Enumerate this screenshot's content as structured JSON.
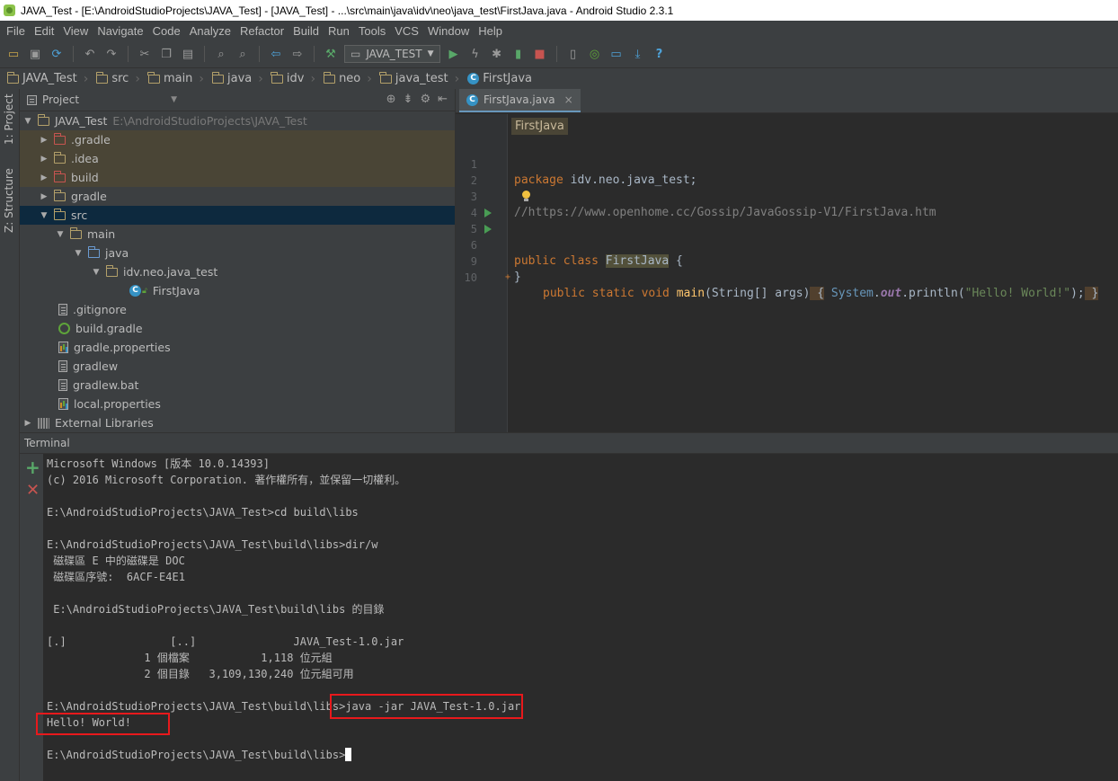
{
  "window": {
    "title": "JAVA_Test - [E:\\AndroidStudioProjects\\JAVA_Test] - [JAVA_Test] - ...\\src\\main\\java\\idv\\neo\\java_test\\FirstJava.java - Android Studio 2.3.1"
  },
  "menu": [
    "File",
    "Edit",
    "View",
    "Navigate",
    "Code",
    "Analyze",
    "Refactor",
    "Build",
    "Run",
    "Tools",
    "VCS",
    "Window",
    "Help"
  ],
  "toolbar": {
    "run_config": "JAVA_TEST"
  },
  "breadcrumb": [
    "JAVA_Test",
    "src",
    "main",
    "java",
    "idv",
    "neo",
    "java_test",
    "FirstJava"
  ],
  "side_tabs": {
    "project": "1: Project",
    "structure": "Z: Structure"
  },
  "project_panel": {
    "header": "Project",
    "root": {
      "name": "JAVA_Test",
      "path": "E:\\AndroidStudioProjects\\JAVA_Test"
    },
    "items": [
      ".gradle",
      ".idea",
      "build",
      "gradle",
      "src",
      "main",
      "java",
      "idv.neo.java_test",
      "FirstJava",
      ".gitignore",
      "build.gradle",
      "gradle.properties",
      "gradlew",
      "gradlew.bat",
      "local.properties",
      "External Libraries"
    ]
  },
  "editor": {
    "tab": "FirstJava.java",
    "crumb": "FirstJava",
    "line_numbers": [
      "1",
      "2",
      "3",
      "4",
      "5",
      "6",
      "9",
      "10"
    ],
    "line1": {
      "kw": "package",
      "rest": " idv.neo.java_test;"
    },
    "line3": "//https://www.openhome.cc/Gossip/JavaGossip-V1/FirstJava.htm",
    "line5": {
      "kw": "public class",
      "cls": "FirstJava",
      "rest": " {"
    },
    "line6": {
      "kw": "public static void",
      "meth": "main",
      "p1": "(String[] args)",
      "b1": " {",
      "sys": "System",
      "dot": ".",
      "out": "out",
      "call": ".println(",
      "str": "\"Hello! World!\"",
      "end": ");",
      "b2": " }"
    },
    "line9": "}"
  },
  "terminal": {
    "header": "Terminal",
    "lines": [
      "Microsoft Windows [版本 10.0.14393]",
      "(c) 2016 Microsoft Corporation. 著作權所有，並保留一切權利。",
      "",
      "E:\\AndroidStudioProjects\\JAVA_Test>cd build\\libs",
      "",
      "E:\\AndroidStudioProjects\\JAVA_Test\\build\\libs>dir/w",
      " 磁碟區 E 中的磁碟是 DOC",
      " 磁碟區序號:  6ACF-E4E1",
      "",
      " E:\\AndroidStudioProjects\\JAVA_Test\\build\\libs 的目錄",
      "",
      "[.]                [..]               JAVA_Test-1.0.jar",
      "               1 個檔案           1,118 位元組",
      "               2 個目錄   3,109,130,240 位元組可用",
      "",
      "E:\\AndroidStudioProjects\\JAVA_Test\\build\\libs>java -jar JAVA_Test-1.0.jar",
      "Hello! World!",
      "",
      "E:\\AndroidStudioProjects\\JAVA_Test\\build\\libs>"
    ]
  },
  "colors": {
    "highlight_box": "#e8191c",
    "selection": "#0d293e",
    "accent": "#6897bb"
  }
}
